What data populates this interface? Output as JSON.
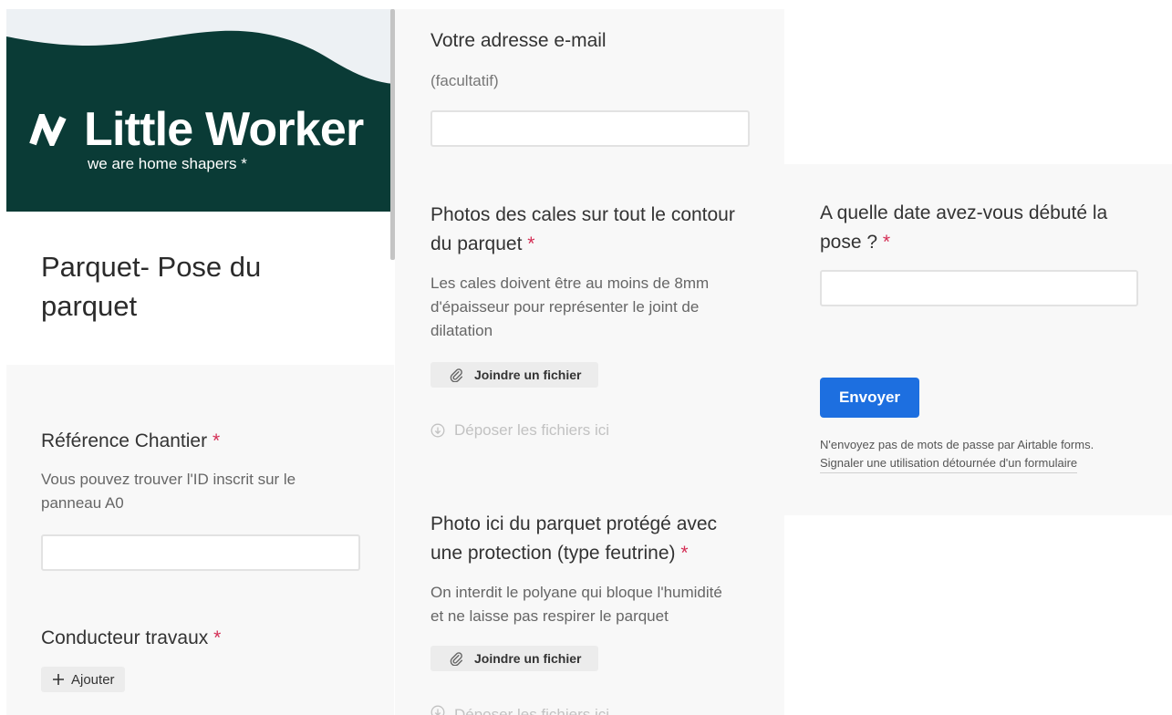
{
  "theme": {
    "brand_green": "#0a3b36",
    "wave": "#edf1f4",
    "required_red": "#d42e55",
    "button_blue": "#1d6fe0"
  },
  "brand": {
    "name": "Little Worker",
    "tagline": "we are home shapers *",
    "logo_icon": "brand-logo-icon"
  },
  "form": {
    "title": "Parquet- Pose du parquet",
    "required_mark": "*"
  },
  "fields": {
    "reference_chantier": {
      "label": "Référence Chantier",
      "description": "Vous pouvez trouver l'ID inscrit sur le panneau A0",
      "value": ""
    },
    "conducteur_travaux": {
      "label": "Conducteur travaux",
      "add_label": "Ajouter"
    },
    "email": {
      "label": "Votre adresse e-mail",
      "hint": "(facultatif)",
      "value": ""
    },
    "photos_cales": {
      "label": "Photos des cales sur tout le contour du parquet",
      "description": "Les cales doivent être au moins de 8mm d'épaisseur pour représenter le joint de dilatation",
      "attach_label": "Joindre un fichier",
      "drop_label": "Déposer les fichiers ici"
    },
    "photo_protection": {
      "label": "Photo ici du parquet protégé avec une protection (type feutrine)",
      "description": "On interdit le polyane qui bloque l'humidité et ne laisse pas respirer le parquet",
      "attach_label": "Joindre un fichier",
      "drop_label": "Déposer les fichiers ici"
    },
    "date_debut": {
      "label": "A quelle date avez-vous débuté la pose ?",
      "value": ""
    }
  },
  "footer": {
    "submit_label": "Envoyer",
    "notice": "N'envoyez pas de mots de passe par Airtable forms.",
    "report_link": "Signaler une utilisation détournée d'un formulaire"
  },
  "icons": {
    "attach": "paperclip-icon",
    "drop": "arrow-down-circle-icon",
    "add": "plus-icon"
  }
}
